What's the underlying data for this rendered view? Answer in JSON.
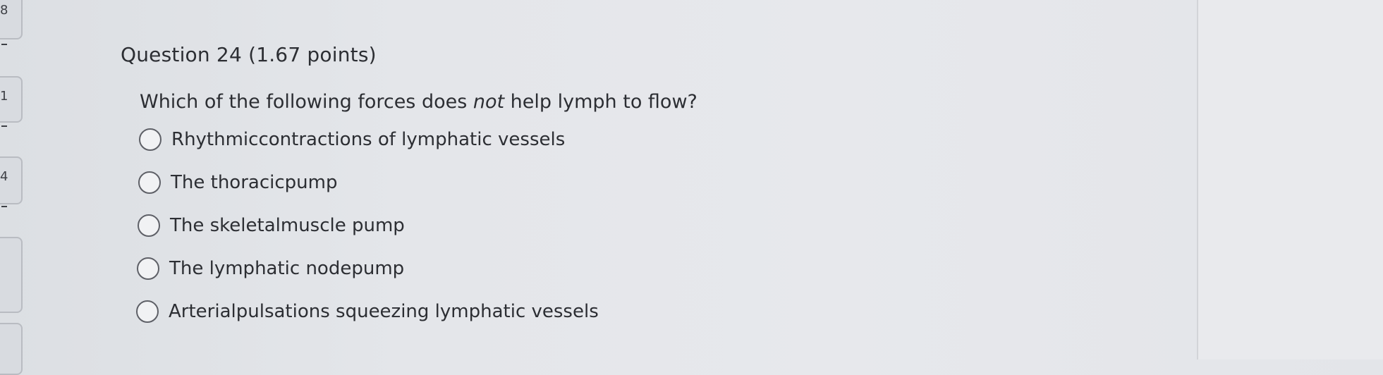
{
  "nav": {
    "numbers": [
      "8",
      "1",
      "4"
    ]
  },
  "question": {
    "title": "Question 24 (1.67 points)",
    "prompt_before": "Which of the following forces does ",
    "prompt_emphasis": "not",
    "prompt_after": " help lymph to flow?"
  },
  "options": [
    {
      "label": "Rhythmiccontractions of lymphatic vessels"
    },
    {
      "label": "The thoracicpump"
    },
    {
      "label": "The skeletalmuscle pump"
    },
    {
      "label": "The lymphatic nodepump"
    },
    {
      "label": "Arterialpulsations squeezing lymphatic vessels"
    }
  ]
}
